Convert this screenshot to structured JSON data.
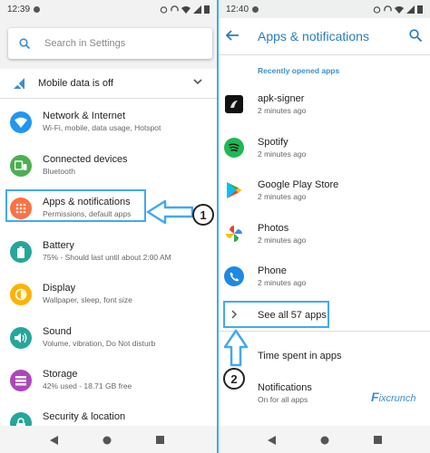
{
  "left": {
    "status": {
      "time": "12:39"
    },
    "search": {
      "placeholder": "Search in Settings"
    },
    "mobile": {
      "label": "Mobile data is off"
    },
    "items": [
      {
        "title": "Network & Internet",
        "subtitle": "Wi-Fi, mobile, data usage, Hotspot",
        "icon": "wifi-icon",
        "color": "#2196f3"
      },
      {
        "title": "Connected devices",
        "subtitle": "Bluetooth",
        "icon": "devices-icon",
        "color": "#4caf50"
      },
      {
        "title": "Apps & notifications",
        "subtitle": "Permissions, default apps",
        "icon": "apps-icon",
        "color": "#ff7043"
      },
      {
        "title": "Battery",
        "subtitle": "75% - Should last until about 2:00 AM",
        "icon": "battery-icon",
        "color": "#26a69a"
      },
      {
        "title": "Display",
        "subtitle": "Wallpaper, sleep, font size",
        "icon": "display-icon",
        "color": "#ffb300"
      },
      {
        "title": "Sound",
        "subtitle": "Volume, vibration, Do Not disturb",
        "icon": "sound-icon",
        "color": "#26a69a"
      },
      {
        "title": "Storage",
        "subtitle": "42% used - 18.71 GB free",
        "icon": "storage-icon",
        "color": "#ab47bc"
      },
      {
        "title": "Security & location",
        "subtitle": "",
        "icon": "lock-icon",
        "color": "#26a69a"
      }
    ],
    "badge": "1"
  },
  "right": {
    "status": {
      "time": "12:40"
    },
    "title": "Apps & notifications",
    "recent_label": "Recently opened apps",
    "apps": [
      {
        "name": "apk-signer",
        "time": "2 minutes ago",
        "icon": "apk-signer-icon"
      },
      {
        "name": "Spotify",
        "time": "2 minutes ago",
        "icon": "spotify-icon"
      },
      {
        "name": "Google Play Store",
        "time": "2 minutes ago",
        "icon": "play-store-icon"
      },
      {
        "name": "Photos",
        "time": "2 minutes ago",
        "icon": "photos-icon"
      },
      {
        "name": "Phone",
        "time": "2 minutes ago",
        "icon": "phone-icon"
      }
    ],
    "see_all": "See all 57 apps",
    "time_spent": "Time spent in apps",
    "notifications": {
      "title": "Notifications",
      "subtitle": "On for all apps"
    },
    "badge": "2",
    "watermark": {
      "first": "F",
      "rest": "ixcrunch"
    }
  },
  "colors": {
    "accent": "#3fa9f5",
    "title": "#2a7db8"
  }
}
